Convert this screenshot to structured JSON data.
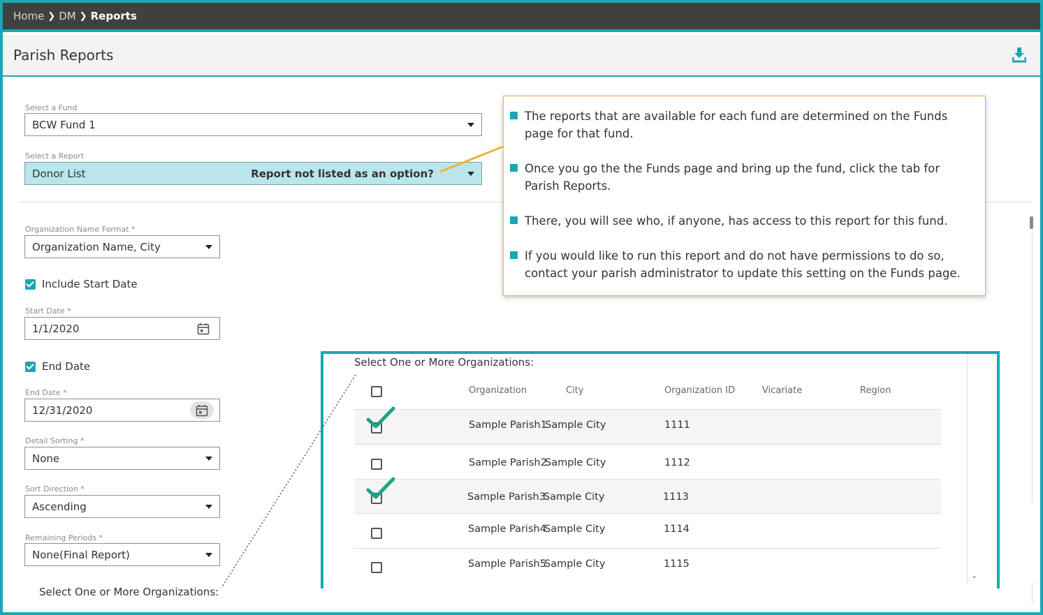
{
  "breadcrumb": {
    "items": [
      "Home",
      "DM"
    ],
    "current": "Reports"
  },
  "page": {
    "title": "Parish Reports"
  },
  "fund": {
    "label": "Select a Fund",
    "value": "BCW Fund 1"
  },
  "report": {
    "label": "Select a Report",
    "value": "Donor List",
    "annotation": "Report not listed as an option?"
  },
  "org_name_format": {
    "label": "Organization Name Format *",
    "value": "Organization Name, City"
  },
  "include_start_date": {
    "label": "Include Start Date",
    "checked": true
  },
  "start_date": {
    "label": "Start Date *",
    "value": "1/1/2020"
  },
  "end_date_toggle": {
    "label": "End Date",
    "checked": true
  },
  "end_date": {
    "label": "End Date *",
    "value": "12/31/2020"
  },
  "detail_sorting": {
    "label": "Detail Sorting *",
    "value": "None"
  },
  "sort_direction": {
    "label": "Sort Direction *",
    "value": "Ascending"
  },
  "remaining_periods": {
    "label": "Remaining Periods *",
    "value": "None(Final Report)"
  },
  "bottom_label": "Select One or More Organizations:",
  "callout": {
    "items": [
      "The reports that are available for each fund are determined on the Funds page for that fund.",
      "Once you go the the Funds page and bring up the fund, click the tab for Parish Reports.",
      "There, you will see who, if anyone, has access to this report for this fund.",
      "If you would like to run this report and do not have permissions to do so, contact your parish administrator to update this setting on the Funds page."
    ]
  },
  "organizations": {
    "title": "Select One or More Organizations:",
    "columns": [
      "Organization",
      "City",
      "Organization ID",
      "Vicariate",
      "Region"
    ],
    "rows": [
      {
        "organization": "Sample Parish1",
        "city": "Sample City",
        "id": "1111",
        "vicariate": "",
        "region": "",
        "selected": true
      },
      {
        "organization": "Sample Parish2",
        "city": "Sample City",
        "id": "1112",
        "vicariate": "",
        "region": "",
        "selected": false
      },
      {
        "organization": "Sample Parish3",
        "city": "Sample City",
        "id": "1113",
        "vicariate": "",
        "region": "",
        "selected": true
      },
      {
        "organization": "Sample Parish4",
        "city": "Sample City",
        "id": "1114",
        "vicariate": "",
        "region": "",
        "selected": false
      },
      {
        "organization": "Sample Parish5",
        "city": "Sample City",
        "id": "1115",
        "vicariate": "",
        "region": "",
        "selected": false
      }
    ]
  },
  "colors": {
    "accent": "#1aa7b4",
    "callout_border": "#f0b03a",
    "highlight_select": "#b9e6ec",
    "checkmark": "#1fa387"
  },
  "icons": {
    "download": "download-icon",
    "calendar": "calendar-icon",
    "dropdown": "caret-down-icon",
    "check": "checkmark-icon"
  }
}
